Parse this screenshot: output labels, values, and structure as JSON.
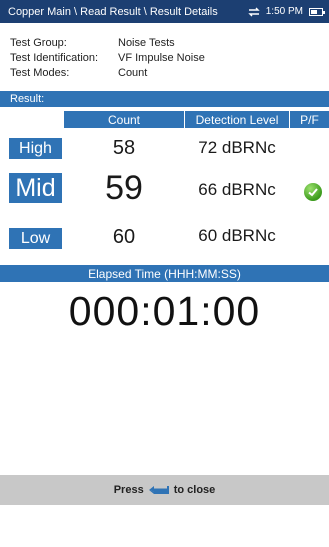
{
  "titlebar": {
    "breadcrumb": "Copper Main \\ Read Result \\ Result Details",
    "time": "1:50 PM"
  },
  "info": [
    {
      "key": "Test Group:",
      "value": "Noise Tests"
    },
    {
      "key": "Test Identification:",
      "value": "VF Impulse Noise"
    },
    {
      "key": "Test Modes:",
      "value": "Count"
    }
  ],
  "result_label": "Result:",
  "columns": {
    "count": "Count",
    "detection_level": "Detection Level",
    "pf": "P/F"
  },
  "rows": [
    {
      "label": "High",
      "count": "58",
      "level": "72 dBRNc"
    },
    {
      "label": "Mid",
      "count": "59",
      "level": "66 dBRNc",
      "pf": "pass"
    },
    {
      "label": "Low",
      "count": "60",
      "level": "60 dBRNc"
    }
  ],
  "elapsed": {
    "label": "Elapsed Time (HHH:MM:SS)",
    "value": "000:01:00"
  },
  "footer": {
    "press": "Press",
    "to_close": "to close"
  },
  "colors": {
    "titlebar": "#1c3f72",
    "accent": "#2f73b5",
    "pass": "#3b9a1c",
    "footer": "#c8c8c8"
  }
}
